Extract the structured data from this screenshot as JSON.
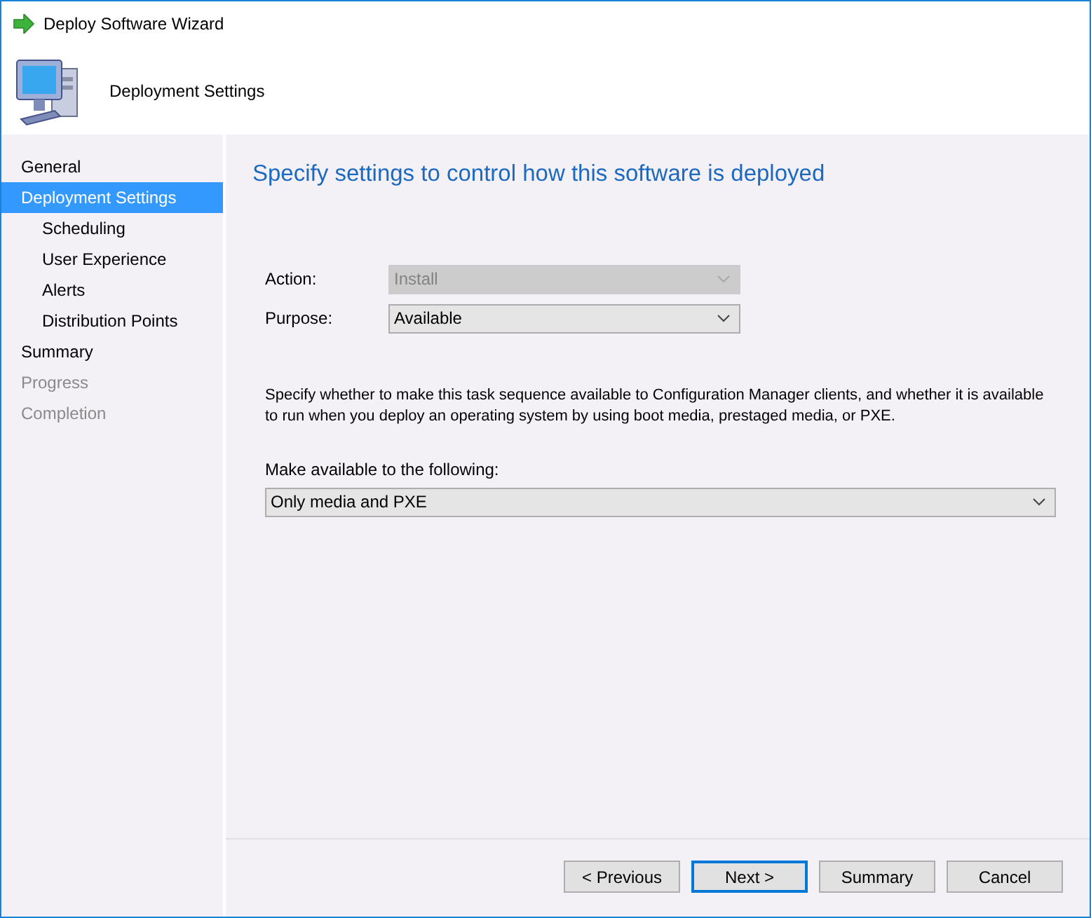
{
  "window": {
    "title": "Deploy Software Wizard"
  },
  "header": {
    "title": "Deployment Settings"
  },
  "sidebar": {
    "items": [
      {
        "label": "General",
        "selected": false,
        "disabled": false
      },
      {
        "label": "Deployment Settings",
        "selected": true,
        "disabled": false,
        "children": [
          {
            "label": "Scheduling",
            "selected": false,
            "disabled": false
          },
          {
            "label": "User Experience",
            "selected": false,
            "disabled": false
          },
          {
            "label": "Alerts",
            "selected": false,
            "disabled": false
          },
          {
            "label": "Distribution Points",
            "selected": false,
            "disabled": false
          }
        ]
      },
      {
        "label": "Summary",
        "selected": false,
        "disabled": false
      },
      {
        "label": "Progress",
        "selected": false,
        "disabled": true
      },
      {
        "label": "Completion",
        "selected": false,
        "disabled": true
      }
    ]
  },
  "content": {
    "heading": "Specify settings to control how this software is deployed",
    "fields": [
      {
        "label": "Action:",
        "value": "Install",
        "disabled": true
      },
      {
        "label": "Purpose:",
        "value": "Available",
        "disabled": false
      }
    ],
    "description": "Specify whether to make this task sequence available to Configuration Manager clients, and whether it is available to run when you deploy an operating system by using boot media, prestaged media, or PXE.",
    "make_available": {
      "label": "Make available to the following:",
      "value": "Only media and PXE",
      "disabled": false
    }
  },
  "buttons": [
    {
      "label": "< Previous",
      "default": false
    },
    {
      "label": "Next >",
      "default": true
    },
    {
      "label": "Summary",
      "default": false
    },
    {
      "label": "Cancel",
      "default": false
    }
  ]
}
